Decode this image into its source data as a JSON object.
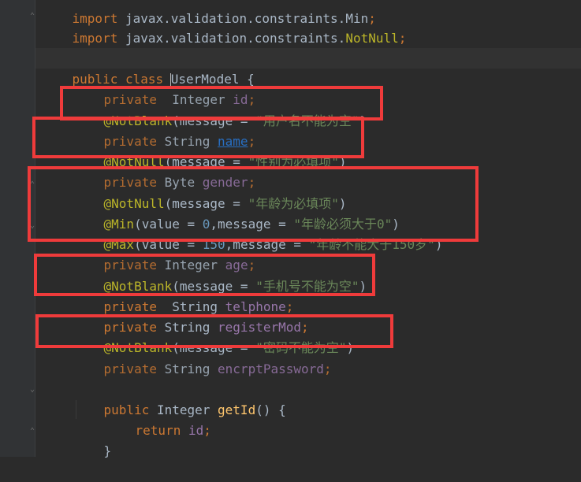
{
  "editor": {
    "lines": {
      "import1": {
        "kw": "import",
        "pkg": " javax.validation.constraints.",
        "cls": "Min",
        "end": ";"
      },
      "import2": {
        "kw": "import",
        "pkg": " javax.validation.constraints.",
        "cls": "NotNull",
        "end": ";"
      },
      "class_decl": {
        "kw1": "public",
        "kw2": " class ",
        "name": "UserModel",
        "brace": " {"
      },
      "id_field": {
        "kw": "private",
        "type": "  Integer ",
        "fld": "id",
        "end": ";"
      },
      "ann_username": {
        "ann": "@NotBlank",
        "p1": "(message = ",
        "str": "\"用户名不能为空\"",
        "p2": ")"
      },
      "name_field": {
        "kw": "private",
        "type": " String ",
        "fld": "name",
        "end": ";"
      },
      "ann_gender": {
        "ann": "@NotNull",
        "p1": "(message = ",
        "str": "\"性别为必填项\"",
        "p2": ")"
      },
      "gender_field": {
        "kw": "private",
        "type": " Byte ",
        "fld": "gender",
        "end": ";"
      },
      "ann_age_notnull": {
        "ann": "@NotNull",
        "p1": "(message = ",
        "str": "\"年龄为必填项\"",
        "p2": ")"
      },
      "ann_age_min": {
        "ann": "@Min",
        "p1": "(value = ",
        "num": "0",
        "p2": ",message = ",
        "str": "\"年龄必须大于0\"",
        "p3": ")"
      },
      "ann_age_max": {
        "ann": "@Max",
        "p1": "(value = ",
        "num": "150",
        "p2": ",message = ",
        "str": "\"年龄不能大于150岁\"",
        "p3": ")"
      },
      "age_field": {
        "kw": "private",
        "type": " Integer ",
        "fld": "age",
        "end": ";"
      },
      "ann_phone": {
        "ann": "@NotBlank",
        "p1": "(message = ",
        "str": "\"手机号不能为空\"",
        "p2": ")"
      },
      "phone_field": {
        "kw": "private",
        "type": "  String ",
        "fld": "telphone",
        "end": ";"
      },
      "register_field": {
        "kw": "private",
        "type": " String ",
        "fld": "registerMod",
        "end": ";"
      },
      "ann_password": {
        "ann": "@NotBlank",
        "p1": "(message = ",
        "str": "\"密码不能为空\"",
        "p2": ")"
      },
      "password_field": {
        "kw": "private",
        "type": " String ",
        "fld": "encrptPassword",
        "end": ";"
      },
      "getid_decl": {
        "kw": "public",
        "type": " Integer ",
        "mth": "getId",
        "rest": "() {"
      },
      "return_stmt": {
        "kw": "return",
        "sp": " ",
        "fld": "id",
        "end": ";"
      },
      "close_brace": {
        "text": "}"
      }
    }
  },
  "colors": {
    "background": "#2b2b2b",
    "keyword": "#cc7832",
    "annotation": "#bbb529",
    "string": "#6a8759",
    "number": "#6897bb",
    "field": "#9876aa",
    "method": "#ffc66d",
    "highlight_box": "#ef3b3b"
  }
}
